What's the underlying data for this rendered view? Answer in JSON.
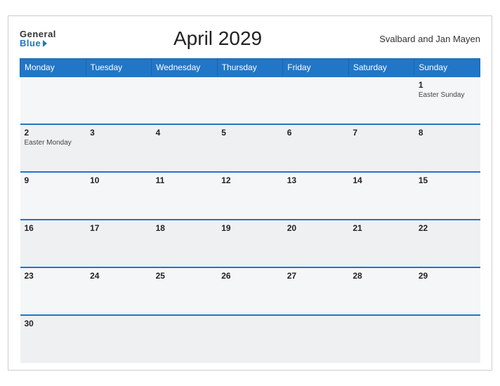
{
  "header": {
    "logo_general": "General",
    "logo_blue": "Blue",
    "title": "April 2029",
    "region": "Svalbard and Jan Mayen"
  },
  "weekdays": [
    "Monday",
    "Tuesday",
    "Wednesday",
    "Thursday",
    "Friday",
    "Saturday",
    "Sunday"
  ],
  "weeks": [
    [
      {
        "day": "",
        "event": ""
      },
      {
        "day": "",
        "event": ""
      },
      {
        "day": "",
        "event": ""
      },
      {
        "day": "",
        "event": ""
      },
      {
        "day": "",
        "event": ""
      },
      {
        "day": "",
        "event": ""
      },
      {
        "day": "1",
        "event": "Easter Sunday"
      }
    ],
    [
      {
        "day": "2",
        "event": "Easter Monday"
      },
      {
        "day": "3",
        "event": ""
      },
      {
        "day": "4",
        "event": ""
      },
      {
        "day": "5",
        "event": ""
      },
      {
        "day": "6",
        "event": ""
      },
      {
        "day": "7",
        "event": ""
      },
      {
        "day": "8",
        "event": ""
      }
    ],
    [
      {
        "day": "9",
        "event": ""
      },
      {
        "day": "10",
        "event": ""
      },
      {
        "day": "11",
        "event": ""
      },
      {
        "day": "12",
        "event": ""
      },
      {
        "day": "13",
        "event": ""
      },
      {
        "day": "14",
        "event": ""
      },
      {
        "day": "15",
        "event": ""
      }
    ],
    [
      {
        "day": "16",
        "event": ""
      },
      {
        "day": "17",
        "event": ""
      },
      {
        "day": "18",
        "event": ""
      },
      {
        "day": "19",
        "event": ""
      },
      {
        "day": "20",
        "event": ""
      },
      {
        "day": "21",
        "event": ""
      },
      {
        "day": "22",
        "event": ""
      }
    ],
    [
      {
        "day": "23",
        "event": ""
      },
      {
        "day": "24",
        "event": ""
      },
      {
        "day": "25",
        "event": ""
      },
      {
        "day": "26",
        "event": ""
      },
      {
        "day": "27",
        "event": ""
      },
      {
        "day": "28",
        "event": ""
      },
      {
        "day": "29",
        "event": ""
      }
    ],
    [
      {
        "day": "30",
        "event": ""
      },
      {
        "day": "",
        "event": ""
      },
      {
        "day": "",
        "event": ""
      },
      {
        "day": "",
        "event": ""
      },
      {
        "day": "",
        "event": ""
      },
      {
        "day": "",
        "event": ""
      },
      {
        "day": "",
        "event": ""
      }
    ]
  ]
}
